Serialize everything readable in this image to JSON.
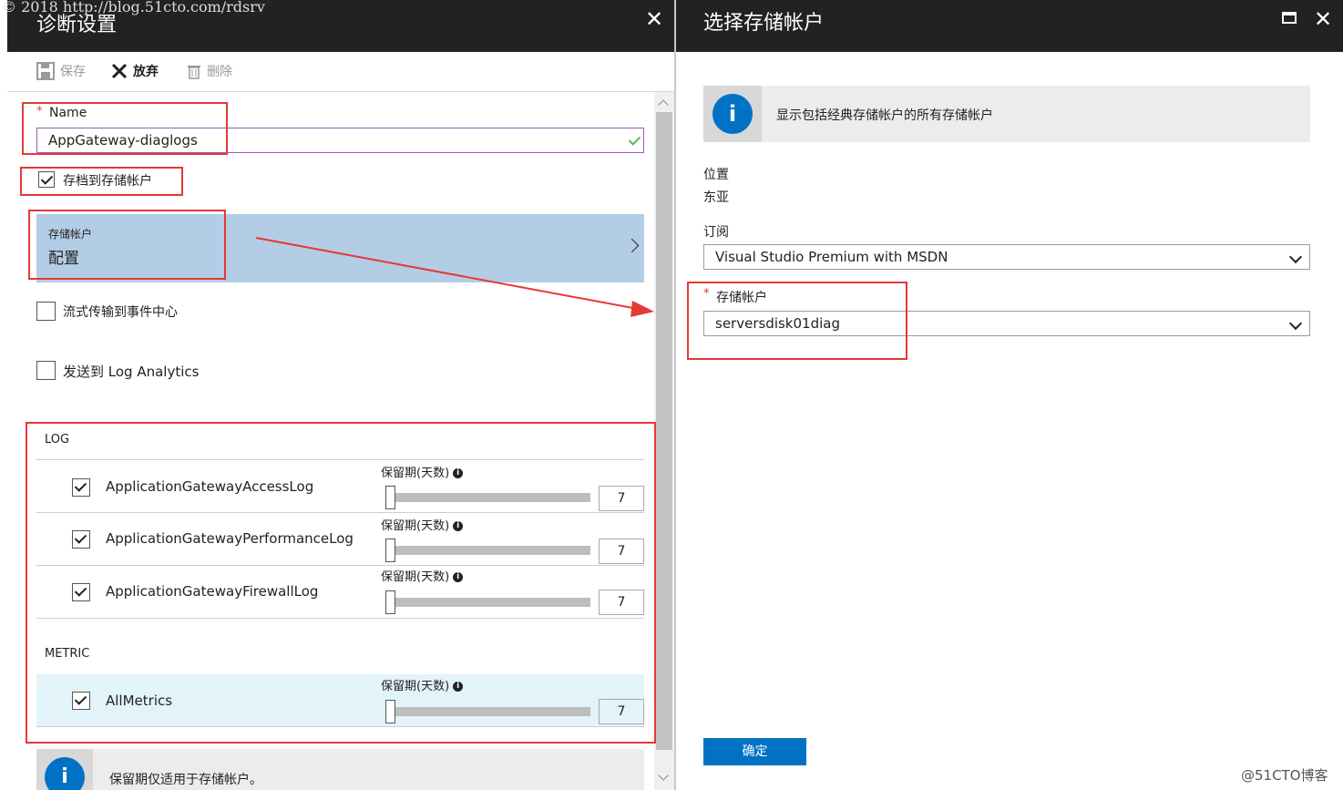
{
  "watermark_top": "© 2018 http://blog.51cto.com/rdsrv",
  "watermark_bottom": "@51CTO博客",
  "left_panel": {
    "title": "诊断设置",
    "close_glyph": "✕",
    "toolbar": {
      "save_label": "保存",
      "discard_label": "放弃",
      "delete_label": "删除"
    },
    "name_field": {
      "required_mark": "*",
      "label": "Name",
      "value": "AppGateway-diaglogs"
    },
    "archive_checkbox": {
      "label": "存档到存储帐户",
      "checked": true
    },
    "storage_account": {
      "caption": "存储帐户",
      "value": "配置"
    },
    "stream_checkbox": {
      "label": "流式传输到事件中心",
      "checked": false
    },
    "log_analytics_checkbox": {
      "label": "发送到 Log Analytics",
      "checked": false
    },
    "log_section": {
      "heading": "LOG",
      "rows": [
        {
          "name": "ApplicationGatewayAccessLog",
          "retention_label": "保留期(天数)",
          "retention_days": "7",
          "checked": true
        },
        {
          "name": "ApplicationGatewayPerformanceLog",
          "retention_label": "保留期(天数)",
          "retention_days": "7",
          "checked": true
        },
        {
          "name": "ApplicationGatewayFirewallLog",
          "retention_label": "保留期(天数)",
          "retention_days": "7",
          "checked": true
        }
      ]
    },
    "metric_section": {
      "heading": "METRIC",
      "rows": [
        {
          "name": "AllMetrics",
          "retention_label": "保留期(天数)",
          "retention_days": "7",
          "checked": true
        }
      ]
    },
    "info_note": "保留期仅适用于存储帐户。"
  },
  "right_panel": {
    "title": "选择存储帐户",
    "info_banner": "显示包括经典存储帐户的所有存储帐户",
    "location_label": "位置",
    "location_value": "东亚",
    "subscription_label": "订阅",
    "subscription_value": "Visual Studio Premium with MSDN",
    "storage_label": "存储帐户",
    "storage_required_mark": "*",
    "storage_value": "serversdisk01diag",
    "ok_button": "确定"
  },
  "colors": {
    "header_bg": "#222222",
    "accent_blue": "#0072c6",
    "highlight_red": "#e53935",
    "selected_row_bg": "#b4cde6",
    "metric_row_bg": "#e2f3fa"
  }
}
